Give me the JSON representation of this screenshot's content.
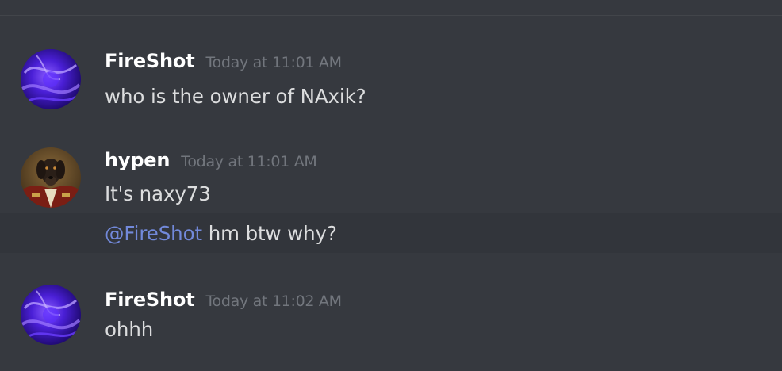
{
  "messages": [
    {
      "username": "FireShot",
      "timestamp": "Today at 11:01 AM",
      "lines": [
        "who is the owner of NAxik?"
      ],
      "avatar_icon": "purple-nebula-avatar"
    },
    {
      "username": "hypen",
      "timestamp": "Today at 11:01 AM",
      "lines": [
        "It's naxy73"
      ],
      "followup": {
        "mention": "@FireShot",
        "text": " hm btw why?"
      },
      "avatar_icon": "dog-portrait-avatar"
    },
    {
      "username": "FireShot",
      "timestamp": "Today at 11:02 AM",
      "lines": [
        "ohhh"
      ],
      "avatar_icon": "purple-nebula-avatar"
    }
  ],
  "colors": {
    "background": "#36393f",
    "username": "#ffffff",
    "timestamp": "#72767d",
    "text": "#dcddde",
    "mention": "#7289da",
    "hover_row": "#32353b"
  }
}
